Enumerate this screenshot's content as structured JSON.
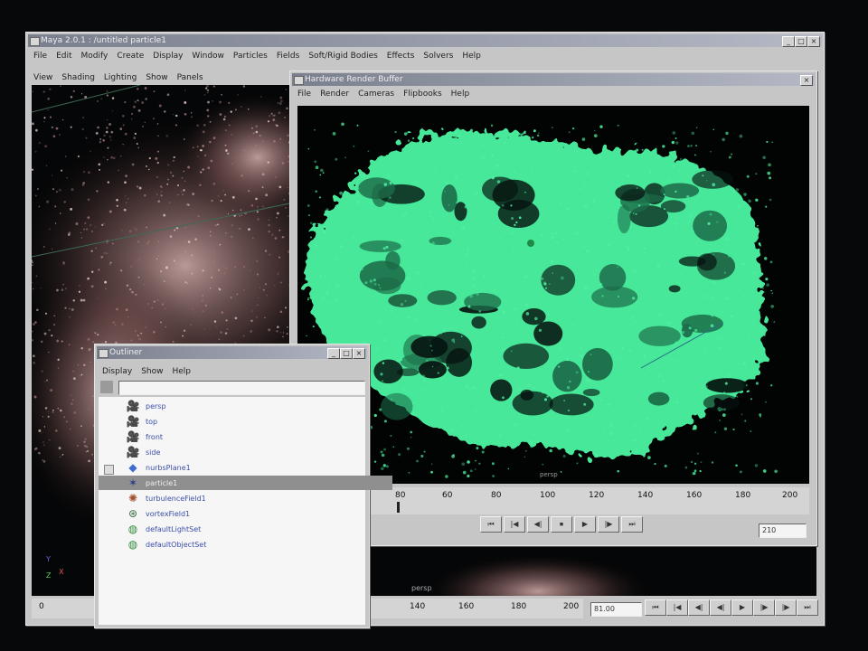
{
  "maya": {
    "title": "Maya 2.0.1 : /untitled    particle1",
    "menus": [
      "File",
      "Edit",
      "Modify",
      "Create",
      "Display",
      "Window",
      "Particles",
      "Fields",
      "Soft/Rigid Bodies",
      "Effects",
      "Solvers",
      "Help"
    ],
    "panel_menus": [
      "View",
      "Shading",
      "Lighting",
      "Show",
      "Panels"
    ],
    "time_ticks": [
      "0",
      "140",
      "160",
      "180",
      "200"
    ],
    "current_time": "81.00",
    "win_buttons": [
      "_",
      "□",
      "×"
    ]
  },
  "render": {
    "title": "Hardware Render Buffer",
    "menus": [
      "File",
      "Render",
      "Cameras",
      "Flipbooks",
      "Help"
    ],
    "camera_label": "persp",
    "time_ticks": [
      "80",
      "60",
      "80",
      "100",
      "120",
      "140",
      "160",
      "180",
      "200"
    ],
    "frame_field": "210",
    "playback": [
      "⏮",
      "|◀",
      "◀|",
      "⏹",
      "▶",
      "|▶",
      "⏭"
    ],
    "colors": {
      "particles": "#4ef0a0",
      "particles_dark": "#1c6b48"
    }
  },
  "outliner": {
    "title": "Outliner",
    "menus": [
      "Display",
      "Show",
      "Help"
    ],
    "search_value": "",
    "items": [
      {
        "label": "persp",
        "icon": "camera-icon"
      },
      {
        "label": "top",
        "icon": "camera-icon"
      },
      {
        "label": "front",
        "icon": "camera-icon"
      },
      {
        "label": "side",
        "icon": "camera-icon"
      },
      {
        "label": "nurbsPlane1",
        "icon": "nurbs-plane-icon"
      },
      {
        "label": "particle1",
        "icon": "particle-icon"
      },
      {
        "label": "turbulenceField1",
        "icon": "turbulence-field-icon"
      },
      {
        "label": "vortexField1",
        "icon": "vortex-field-icon"
      },
      {
        "label": "defaultLightSet",
        "icon": "light-set-icon"
      },
      {
        "label": "defaultObjectSet",
        "icon": "object-set-icon"
      }
    ]
  },
  "viewport_label": "persp",
  "axis_labels": {
    "y": "Y",
    "x": "X",
    "z": "Z"
  }
}
